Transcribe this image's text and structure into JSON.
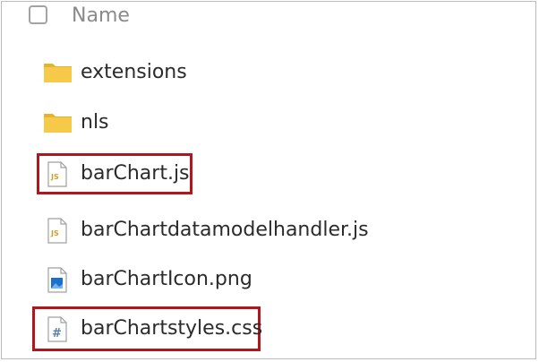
{
  "header": {
    "name_label": "Name"
  },
  "files": [
    {
      "name": "extensions",
      "icon": "folder-icon"
    },
    {
      "name": "nls",
      "icon": "folder-icon"
    },
    {
      "name": "barChart.js",
      "icon": "js-file-icon",
      "highlighted": true
    },
    {
      "name": "barChartdatamodelhandler.js",
      "icon": "js-file-icon"
    },
    {
      "name": "barChartIcon.png",
      "icon": "png-file-icon"
    },
    {
      "name": "barChartstyles.css",
      "icon": "css-file-icon",
      "highlighted": true
    }
  ],
  "colors": {
    "highlight": "#b0161e",
    "folder": "#f7c94a",
    "js_badge": "#c9a227",
    "png_badge": "#1e6fc8",
    "css_badge": "#5b7fa8"
  },
  "icon_text": {
    "js": "JS",
    "css": "#"
  }
}
